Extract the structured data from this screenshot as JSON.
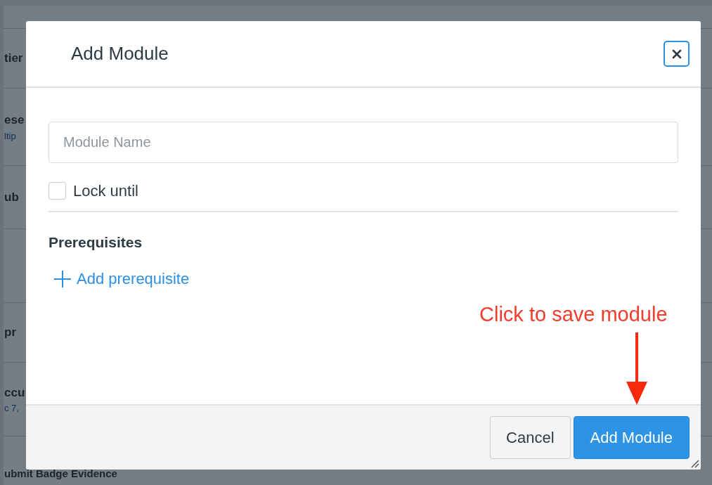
{
  "background_list": [
    {
      "title": "tier"
    },
    {
      "title": "ese",
      "subtitle": "ltip"
    },
    {
      "title": "ub"
    },
    {
      "title": "pr"
    },
    {
      "title": "ccu",
      "subtitle": "c 7,"
    },
    {
      "title": "ubmit Badge Evidence"
    }
  ],
  "dialog": {
    "title": "Add Module",
    "name_field": {
      "placeholder": "Module Name"
    },
    "lock_until": {
      "label": "Lock until",
      "checked": false
    },
    "prerequisites": {
      "heading": "Prerequisites",
      "add_link": "Add prerequisite"
    },
    "buttons": [
      {
        "label": "Cancel",
        "kind": "secondary"
      },
      {
        "label": "Add Module",
        "kind": "primary"
      }
    ]
  },
  "annotation": {
    "text": "Click to save module"
  }
}
